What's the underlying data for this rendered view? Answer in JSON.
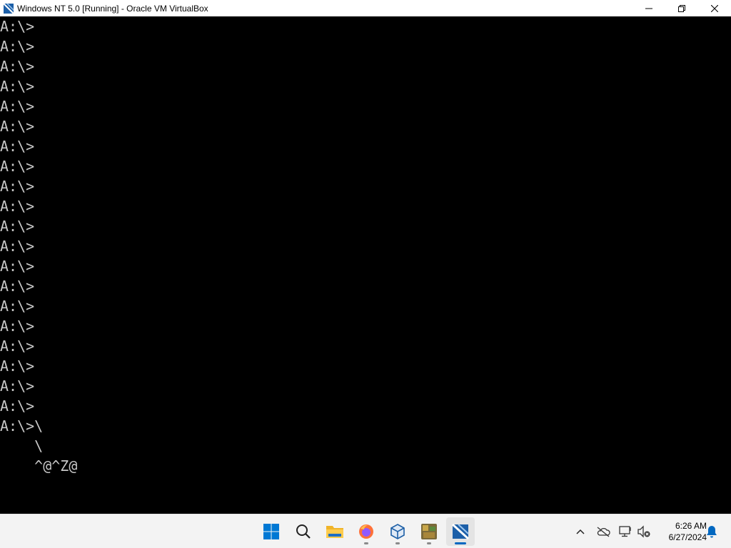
{
  "window": {
    "title": "Windows NT 5.0 [Running] - Oracle VM VirtualBox",
    "icon": "virtualbox-icon",
    "controls": [
      "minimize-icon",
      "restore-icon",
      "close-icon"
    ]
  },
  "console": {
    "lines": [
      "A:\\>",
      "A:\\>",
      "A:\\>",
      "A:\\>",
      "A:\\>",
      "A:\\>",
      "A:\\>",
      "A:\\>",
      "A:\\>",
      "A:\\>",
      "A:\\>",
      "A:\\>",
      "A:\\>",
      "A:\\>",
      "A:\\>",
      "A:\\>",
      "A:\\>",
      "A:\\>",
      "A:\\>",
      "A:\\>",
      "A:\\>\\",
      "    \\",
      "    ^@^Z@"
    ],
    "fg_color": "#c8c8c8",
    "bg_color": "#000000"
  },
  "taskbar": {
    "apps": [
      {
        "name": "start-icon",
        "running": false,
        "active": false
      },
      {
        "name": "search-icon",
        "running": false,
        "active": false
      },
      {
        "name": "file-explorer-icon",
        "running": false,
        "active": false
      },
      {
        "name": "firefox-icon",
        "running": true,
        "active": false
      },
      {
        "name": "virtualbox-manager-icon",
        "running": true,
        "active": false
      },
      {
        "name": "game-app-icon",
        "running": true,
        "active": false
      },
      {
        "name": "virtualbox-vm-icon",
        "running": true,
        "active": true
      }
    ],
    "tray": {
      "icons": [
        "chevron-up-icon",
        "onedrive-offline-icon",
        "network-icon",
        "volume-muted-icon",
        "notification-bell-icon"
      ],
      "time": "6:26 AM",
      "date": "6/27/2024"
    },
    "accent": "#0067c0"
  }
}
